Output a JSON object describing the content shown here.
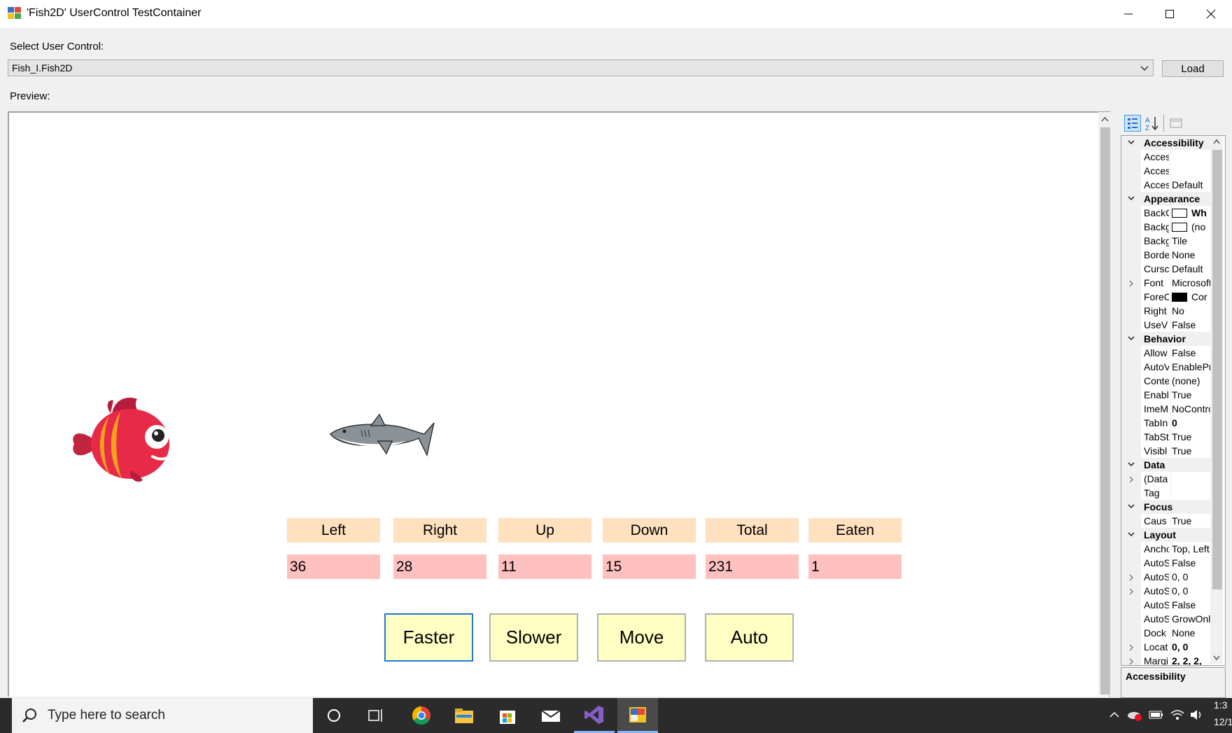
{
  "window": {
    "title": "'Fish2D' UserControl TestContainer"
  },
  "top": {
    "select_label": "Select User Control:",
    "combo_value": "Fish_I.Fish2D",
    "load_label": "Load",
    "preview_label": "Preview:"
  },
  "stats": {
    "headers": [
      "Left",
      "Right",
      "Up",
      "Down",
      "Total",
      "Eaten"
    ],
    "values": [
      "36",
      "28",
      "11",
      "15",
      "231",
      "1"
    ]
  },
  "buttons": {
    "faster": "Faster",
    "slower": "Slower",
    "move": "Move",
    "auto": "Auto"
  },
  "property_grid": {
    "rows": [
      {
        "type": "cat",
        "name": "Accessibility"
      },
      {
        "type": "prop",
        "name": "Acces",
        "value": ""
      },
      {
        "type": "prop",
        "name": "Acces",
        "value": ""
      },
      {
        "type": "prop",
        "name": "Acces",
        "value": "Default"
      },
      {
        "type": "cat",
        "name": "Appearance"
      },
      {
        "type": "prop",
        "name": "BackC",
        "value": "Wh",
        "swatch": "#ffffff",
        "bold": true
      },
      {
        "type": "prop",
        "name": "Backg",
        "value": "(no",
        "swatch": "#ffffff"
      },
      {
        "type": "prop",
        "name": "Backg",
        "value": "Tile"
      },
      {
        "type": "prop",
        "name": "Borde",
        "value": "None"
      },
      {
        "type": "prop",
        "name": "Cursc",
        "value": "Default"
      },
      {
        "type": "prop",
        "name": "Font",
        "value": "Microsoft",
        "expand": true
      },
      {
        "type": "prop",
        "name": "ForeC",
        "value": "Cor",
        "swatch": "#000000"
      },
      {
        "type": "prop",
        "name": "Right",
        "value": "No"
      },
      {
        "type": "prop",
        "name": "UseV",
        "value": "False"
      },
      {
        "type": "cat",
        "name": "Behavior"
      },
      {
        "type": "prop",
        "name": "Allow",
        "value": "False"
      },
      {
        "type": "prop",
        "name": "AutoV",
        "value": "EnablePr"
      },
      {
        "type": "prop",
        "name": "Conte",
        "value": "(none)"
      },
      {
        "type": "prop",
        "name": "Enabl",
        "value": "True"
      },
      {
        "type": "prop",
        "name": "ImeM",
        "value": "NoContro"
      },
      {
        "type": "prop",
        "name": "TabIn",
        "value": "0",
        "bold": true
      },
      {
        "type": "prop",
        "name": "TabSt",
        "value": "True"
      },
      {
        "type": "prop",
        "name": "Visibl",
        "value": "True"
      },
      {
        "type": "cat",
        "name": "Data"
      },
      {
        "type": "prop",
        "name": "(Data",
        "value": "",
        "expand": true
      },
      {
        "type": "prop",
        "name": "Tag",
        "value": ""
      },
      {
        "type": "cat",
        "name": "Focus"
      },
      {
        "type": "prop",
        "name": "Caus",
        "value": "True"
      },
      {
        "type": "cat",
        "name": "Layout"
      },
      {
        "type": "prop",
        "name": "Ancho",
        "value": "Top, Left"
      },
      {
        "type": "prop",
        "name": "AutoS",
        "value": "False"
      },
      {
        "type": "prop",
        "name": "AutoS",
        "value": "0, 0",
        "expand": true
      },
      {
        "type": "prop",
        "name": "AutoS",
        "value": "0, 0",
        "expand": true
      },
      {
        "type": "prop",
        "name": "AutoS",
        "value": "False"
      },
      {
        "type": "prop",
        "name": "AutoS",
        "value": "GrowOnl"
      },
      {
        "type": "prop",
        "name": "Dock",
        "value": "None"
      },
      {
        "type": "prop",
        "name": "Locat",
        "value": "0, 0",
        "expand": true,
        "bold": true
      },
      {
        "type": "prop",
        "name": "Margi",
        "value": "2, 2, 2,",
        "expand": true,
        "bold": true
      }
    ],
    "description_title": "Accessibility"
  },
  "taskbar": {
    "search_placeholder": "Type here to search",
    "time": "1:3",
    "date": "12/1"
  },
  "icons": {
    "app": "app-icon",
    "minimize": "minimize-icon",
    "maximize": "maximize-icon",
    "close": "close-icon",
    "fish": "red-fish-image",
    "shark": "shark-image"
  }
}
